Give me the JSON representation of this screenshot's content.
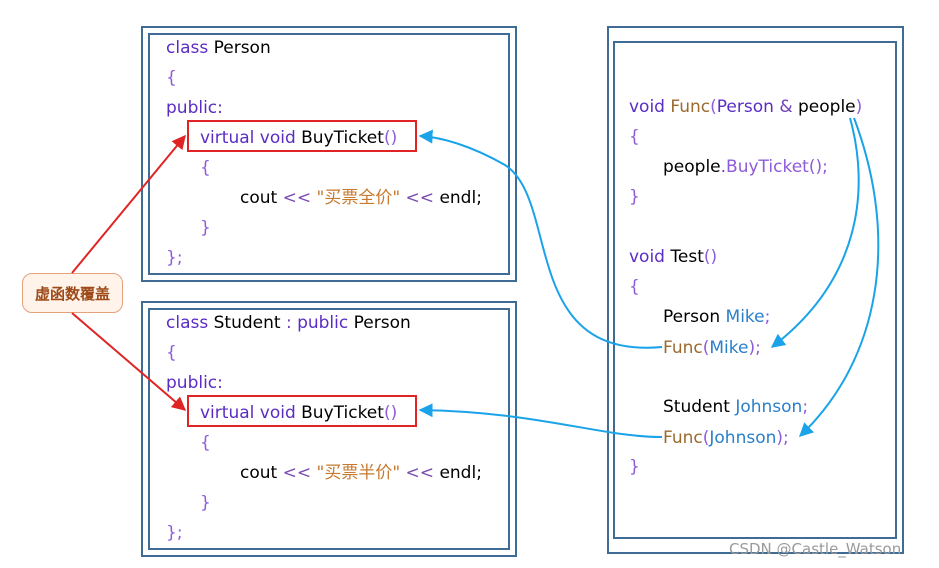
{
  "person": {
    "line1_kw": "class",
    "line1_name": " Person",
    "open_brace": "{",
    "access": "public:",
    "method_kw": "virtual void ",
    "method_name": "BuyTicket",
    "method_parens": "()",
    "inner_open": "{",
    "cout": "cout ",
    "op1": "<<",
    "str": " \"买票全价\" ",
    "op2": "<<",
    "endl": " endl;",
    "inner_close": "}",
    "close": "};"
  },
  "student": {
    "line1_kw": "class",
    "line1_name": " Student ",
    "colon": ": ",
    "public_kw": "public",
    "base": " Person",
    "open_brace": "{",
    "access": "public:",
    "method_kw": "virtual void ",
    "method_name": "BuyTicket",
    "method_parens": "()",
    "inner_open": "{",
    "cout": "cout ",
    "op1": "<<",
    "str": " \"买票半价\" ",
    "op2": "<<",
    "endl": " endl;",
    "inner_close": "}",
    "close": "};"
  },
  "right": {
    "func_kw": "void ",
    "func_name": "Func",
    "func_paren_open": "(",
    "func_type": "Person",
    "func_amp": " & ",
    "func_param": "people",
    "func_paren_close": ")",
    "func_open": "{",
    "call_obj": "people",
    "call_dot": ".",
    "call_method": "BuyTicket",
    "call_rest": "();",
    "func_close": "}",
    "test_kw": "void ",
    "test_name": "Test",
    "test_parens": "()",
    "test_open": "{",
    "decl1_type": "Person ",
    "decl1_var": "Mike",
    "decl1_semi": ";",
    "call1_fn": "Func",
    "call1_open": "(",
    "call1_arg": "Mike",
    "call1_close": ");",
    "decl2_type": "Student ",
    "decl2_var": "Johnson",
    "decl2_semi": ";",
    "call2_fn": "Func",
    "call2_open": "(",
    "call2_arg": "Johnson",
    "call2_close": ");",
    "test_close": "}"
  },
  "badge_label": "虚函数覆盖",
  "watermark": "CSDN @Castle_Watson",
  "colors": {
    "frame": "#3f6c95",
    "highlight": "#e02424",
    "arrow_blue": "#1aa3e8",
    "arrow_red": "#e02424"
  }
}
